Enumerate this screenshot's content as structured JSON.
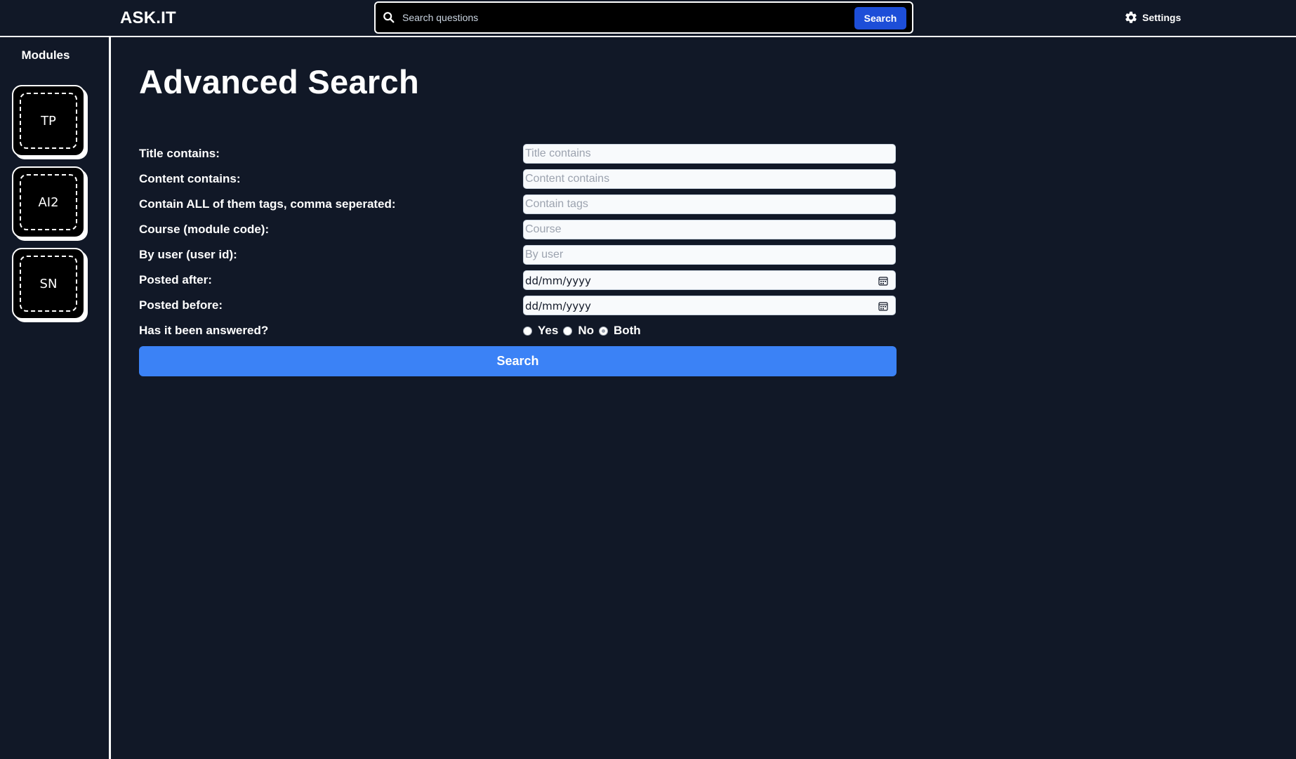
{
  "header": {
    "logo": "ASK.IT",
    "search_placeholder": "Search questions",
    "search_button": "Search",
    "settings_label": "Settings"
  },
  "sidebar": {
    "title": "Modules",
    "modules": [
      "TP",
      "AI2",
      "SN"
    ]
  },
  "main": {
    "title": "Advanced Search",
    "fields": {
      "title": {
        "label": "Title contains:",
        "placeholder": "Title contains"
      },
      "content": {
        "label": "Content contains:",
        "placeholder": "Content contains"
      },
      "tags": {
        "label": "Contain ALL of them tags, comma seperated:",
        "placeholder": "Contain tags"
      },
      "course": {
        "label": "Course (module code):",
        "placeholder": "Course"
      },
      "user": {
        "label": "By user (user id):",
        "placeholder": "By user"
      },
      "after": {
        "label": "Posted after:",
        "value": "dd/mm/yyyy"
      },
      "before": {
        "label": "Posted before:",
        "value": "dd/mm/yyyy"
      },
      "answered": {
        "label": "Has it been answered?",
        "options": [
          "Yes",
          "No",
          "Both"
        ],
        "selected": "Both"
      }
    },
    "submit_label": "Search"
  },
  "colors": {
    "background": "#111827",
    "primary_button": "#3b82f6",
    "top_search_button": "#1d4ed8",
    "module_tile": "#000000"
  }
}
